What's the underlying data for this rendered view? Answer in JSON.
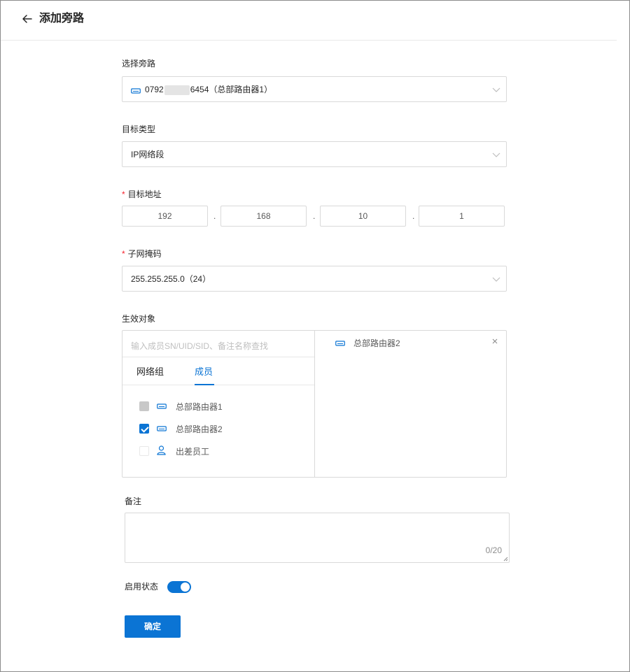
{
  "header": {
    "title": "添加旁路"
  },
  "bypass": {
    "label": "选择旁路",
    "value_prefix": "0792",
    "value_suffix": "6454（总部路由器1）"
  },
  "target_type": {
    "label": "目标类型",
    "value": "IP网络段"
  },
  "target_address": {
    "label": "目标地址",
    "required_mark": "*",
    "octets": [
      "192",
      "168",
      "10",
      "1"
    ],
    "separator": "."
  },
  "subnet_mask": {
    "label": "子网掩码",
    "required_mark": "*",
    "value": "255.255.255.0（24）"
  },
  "effective_objects": {
    "label": "生效对象",
    "search_placeholder": "输入成员SN/UID/SID、备注名称查找",
    "tabs": [
      {
        "label": "网络组"
      },
      {
        "label": "成员"
      }
    ],
    "active_tab": "成员",
    "members": [
      {
        "label": "总部路由器1",
        "state": "disabled",
        "icon": "router-icon"
      },
      {
        "label": "总部路由器2",
        "state": "checked",
        "icon": "router-icon"
      },
      {
        "label": "出差员工",
        "state": "unchecked",
        "icon": "user-icon"
      }
    ],
    "selected": [
      {
        "label": "总部路由器2",
        "icon": "router-icon"
      }
    ]
  },
  "remark": {
    "label": "备注",
    "counter": "0/20"
  },
  "enable": {
    "label": "启用状态",
    "on": true
  },
  "submit": {
    "label": "确定"
  },
  "colors": {
    "primary": "#0b74d4",
    "required": "#f5222d",
    "border": "#d9d9d9"
  }
}
